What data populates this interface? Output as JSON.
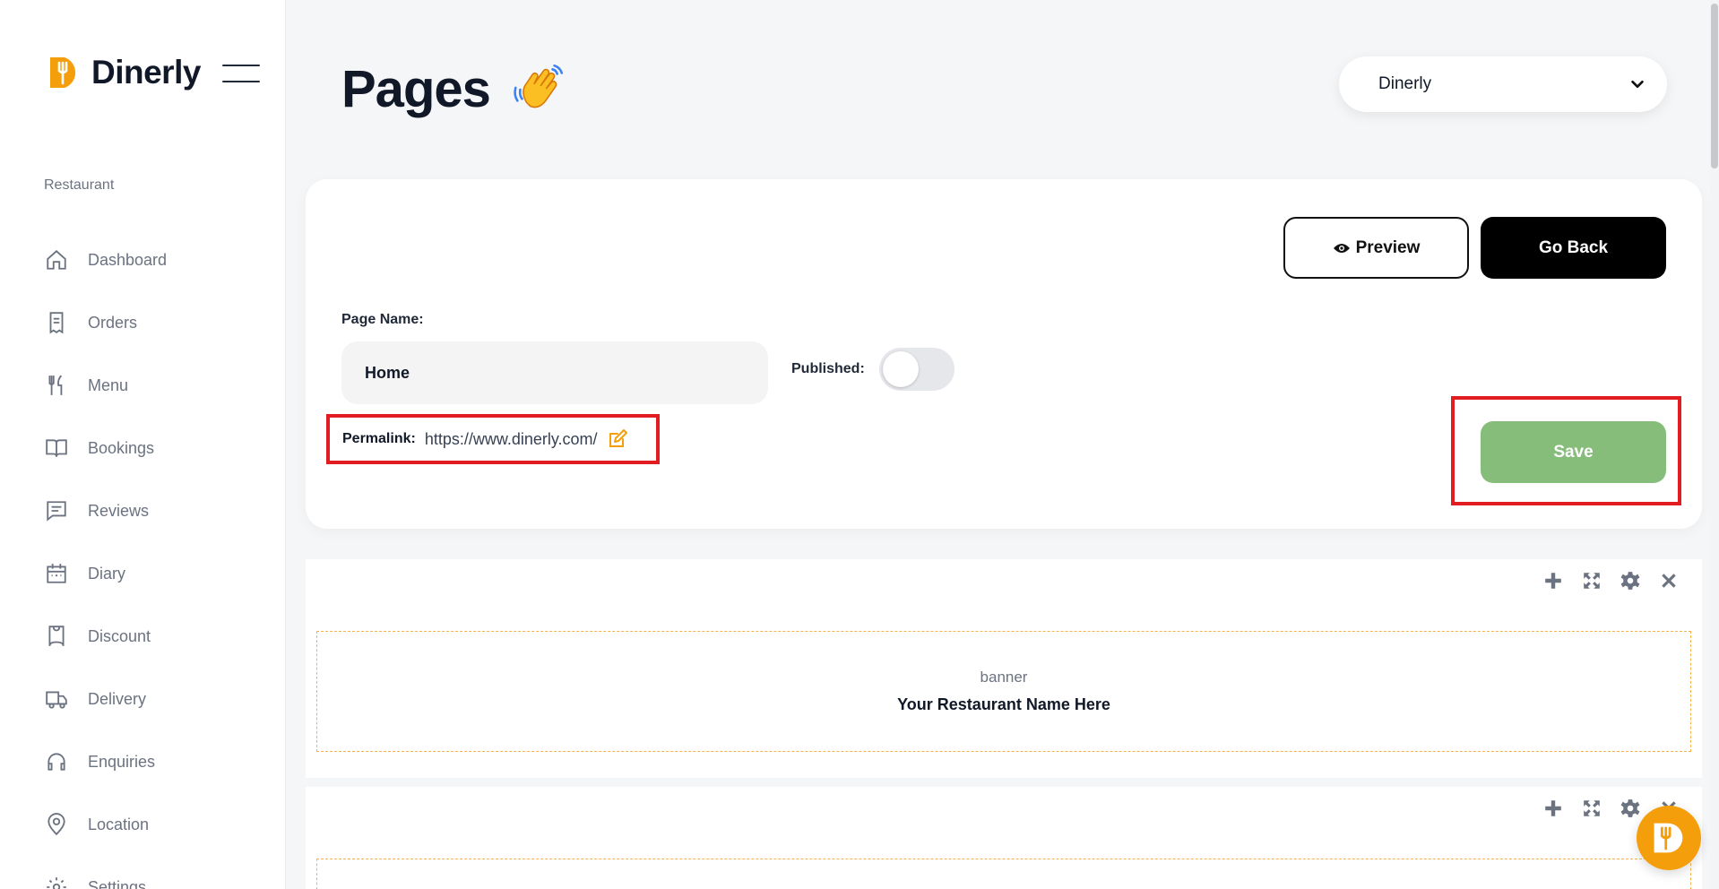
{
  "brand": {
    "name": "Dinerly"
  },
  "sidebar": {
    "section_label": "Restaurant",
    "items": [
      {
        "label": "Dashboard",
        "icon": "home-icon"
      },
      {
        "label": "Orders",
        "icon": "receipt-icon"
      },
      {
        "label": "Menu",
        "icon": "utensils-icon"
      },
      {
        "label": "Bookings",
        "icon": "book-icon"
      },
      {
        "label": "Reviews",
        "icon": "message-icon"
      },
      {
        "label": "Diary",
        "icon": "calendar-icon"
      },
      {
        "label": "Discount",
        "icon": "ticket-icon"
      },
      {
        "label": "Delivery",
        "icon": "truck-icon"
      },
      {
        "label": "Enquiries",
        "icon": "headset-icon"
      },
      {
        "label": "Location",
        "icon": "map-pin-icon"
      },
      {
        "label": "Settings",
        "icon": "gear-icon"
      }
    ]
  },
  "header": {
    "title": "Pages",
    "site_select": {
      "value": "Dinerly"
    }
  },
  "editor": {
    "preview_label": "Preview",
    "go_back_label": "Go Back",
    "page_name_label": "Page Name:",
    "page_name_value": "Home",
    "published_label": "Published:",
    "published": false,
    "permalink_label": "Permalink:",
    "permalink_url": "https://www.dinerly.com/",
    "save_label": "Save"
  },
  "sections": [
    {
      "kind": "banner",
      "title": "Your Restaurant Name Here"
    },
    {
      "kind": "",
      "title": ""
    }
  ],
  "colors": {
    "accent": "#f59e0b",
    "save": "#86bd7b",
    "highlight": "#e11d22",
    "dash": "#f5b24a"
  }
}
